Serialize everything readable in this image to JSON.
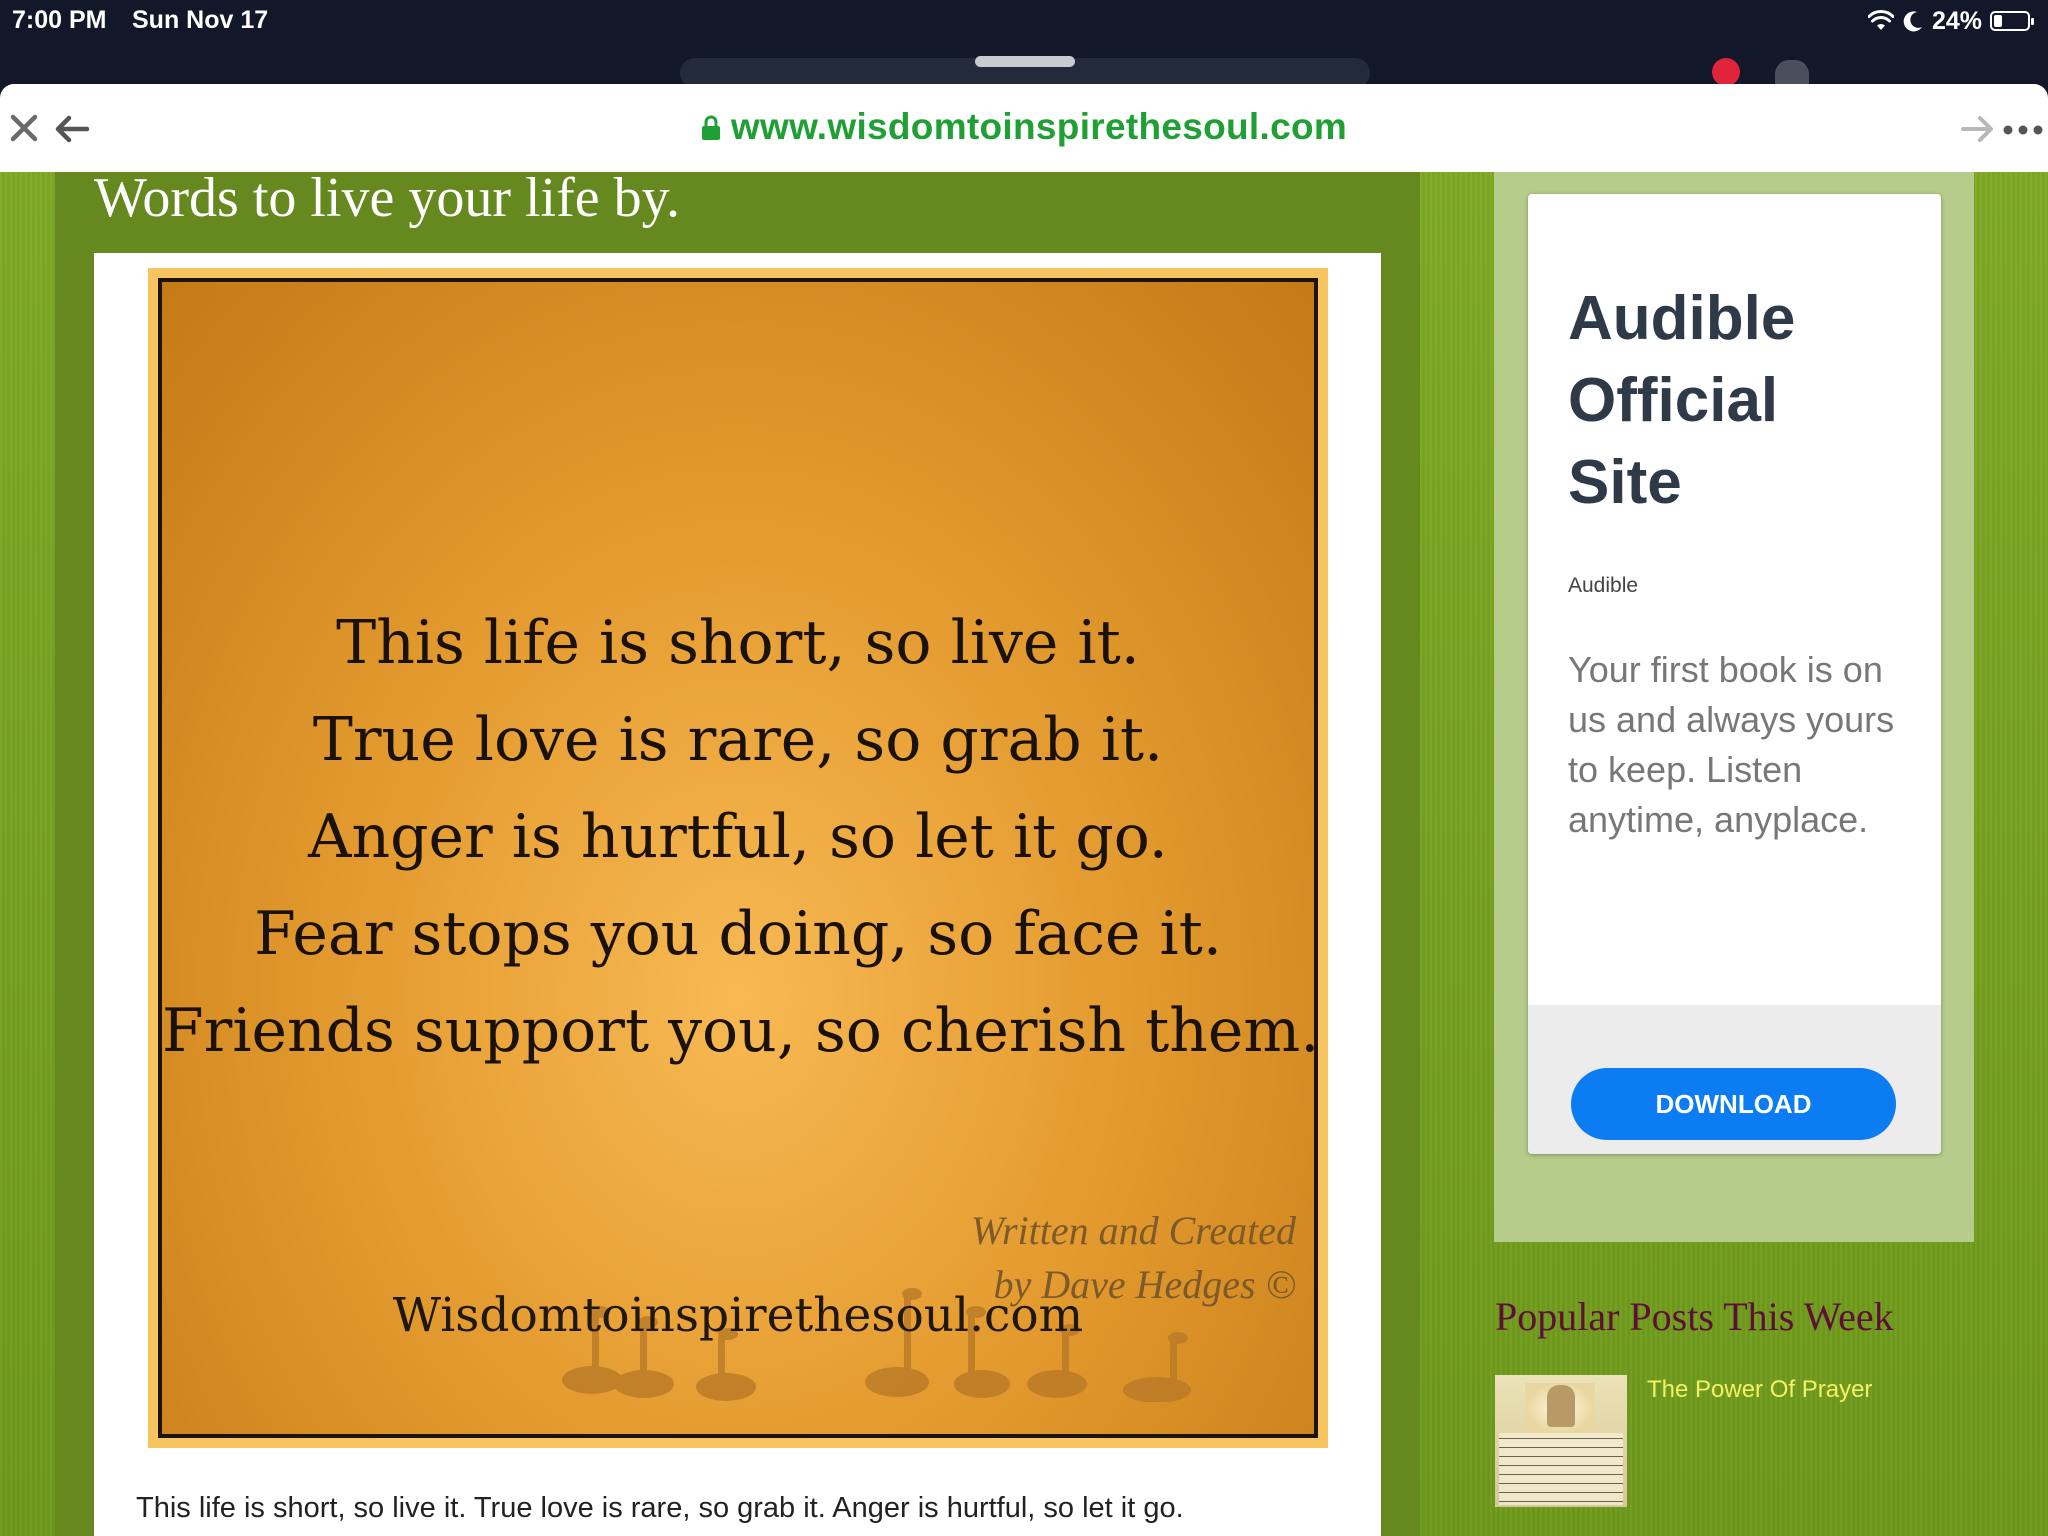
{
  "status_bar": {
    "time": "7:00 PM",
    "date": "Sun Nov 17",
    "battery": "24%",
    "battery_level": 0.24
  },
  "browser": {
    "url": "www.wisdomtoinspirethesoul.com"
  },
  "post": {
    "title": "Words to live your life by.",
    "quote_lines": [
      "This life is short, so live it.",
      "True love is rare, so grab it.",
      "Anger is hurtful, so let it go.",
      "Fear stops you doing, so face it.",
      "Friends support you, so cherish them."
    ],
    "credit_line1": "Written and Created",
    "credit_line2": "by Dave Hedges ©",
    "image_site": "Wisdomtoinspirethesoul.com",
    "body_text": "This life is short, so live it. True love is rare, so grab it. Anger is hurtful, so let it go."
  },
  "ad": {
    "title": "Audible Official Site",
    "brand": "Audible",
    "body": "Your first book is on us and always yours to keep. Listen anytime, anyplace.",
    "button_label": "DOWNLOAD"
  },
  "sidebar": {
    "popular_heading": "Popular Posts This Week",
    "posts": [
      {
        "title": "The Power Of Prayer"
      }
    ]
  },
  "colors": {
    "url_green": "#1f9f34",
    "page_green": "#7faa24",
    "button_blue": "#0b7cf1",
    "heading_maroon": "#5c1038",
    "link_yellow": "#f4f067"
  }
}
